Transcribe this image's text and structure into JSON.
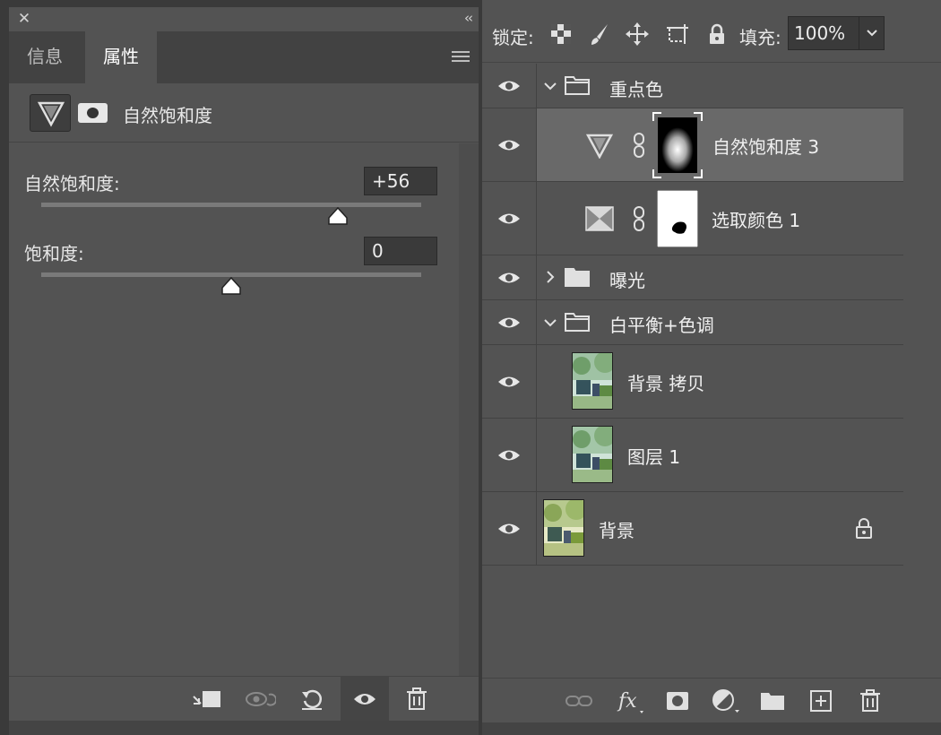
{
  "properties_panel": {
    "tabs": [
      {
        "label": "信息"
      },
      {
        "label": "属性"
      }
    ],
    "title": "自然饱和度",
    "sliders": [
      {
        "label": "自然饱和度:",
        "value": "+56",
        "fraction": 0.78
      },
      {
        "label": "饱和度:",
        "value": "0",
        "fraction": 0.5
      }
    ]
  },
  "layers_panel": {
    "lock_label": "锁定:",
    "fill_label": "填充:",
    "fill_value": "100%",
    "layers": [
      {
        "name": "重点色",
        "kind": "group",
        "expanded": true
      },
      {
        "name": "自然饱和度 3",
        "kind": "vibrance-adjustment",
        "selected": true
      },
      {
        "name": "选取颜色 1",
        "kind": "selective-color-adjustment"
      },
      {
        "name": "曝光",
        "kind": "group",
        "expanded": false
      },
      {
        "name": "白平衡+色调",
        "kind": "group",
        "expanded": true
      },
      {
        "name": "背景 拷贝",
        "kind": "pixel"
      },
      {
        "name": "图层 1",
        "kind": "pixel"
      },
      {
        "name": "背景",
        "kind": "background",
        "locked": true
      }
    ]
  },
  "colors": {
    "panel_bg": "#535353",
    "selected_row": "#696969",
    "icon": "#d4d4d4"
  }
}
